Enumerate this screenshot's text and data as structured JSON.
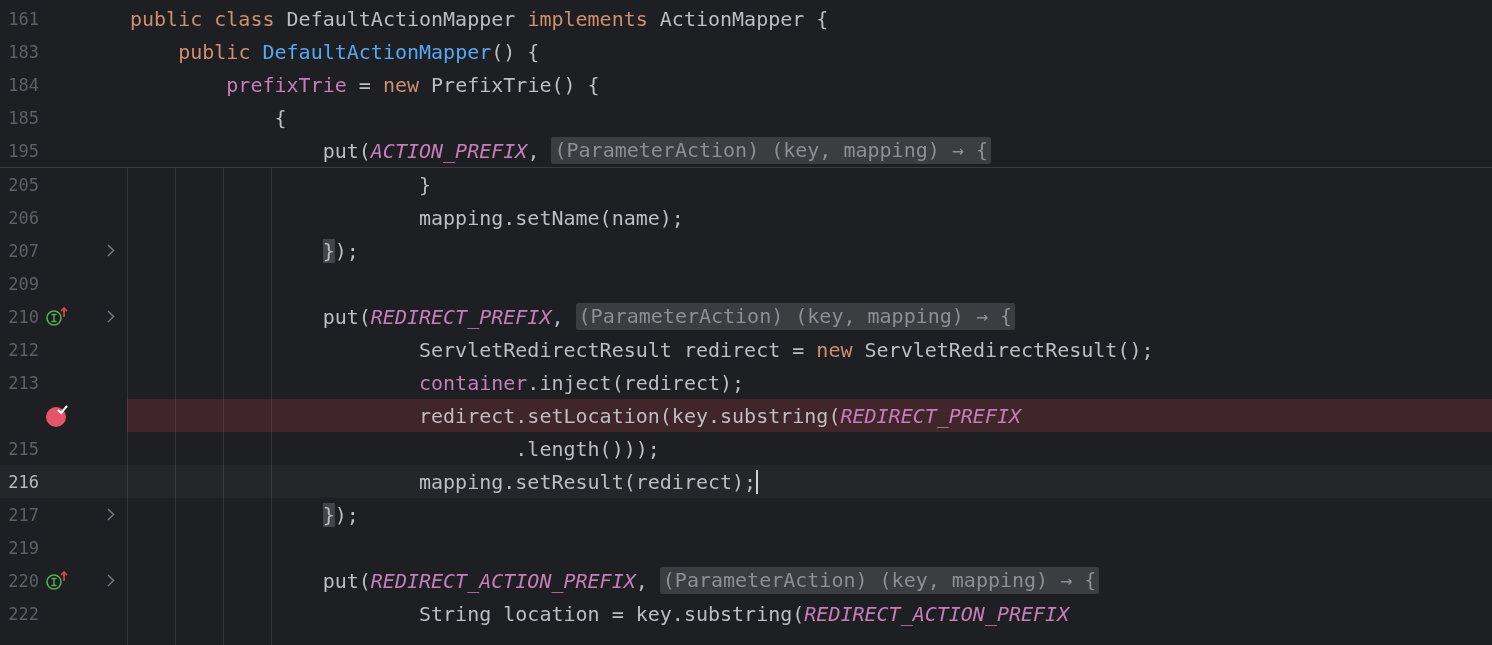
{
  "editor": {
    "sticky_lines": [
      {
        "number": "161",
        "tokens": [
          {
            "kind": "keyword",
            "text": "public class "
          },
          {
            "kind": "plain",
            "text": "DefaultActionMapper "
          },
          {
            "kind": "keyword",
            "text": "implements "
          },
          {
            "kind": "plain",
            "text": "ActionMapper {"
          }
        ]
      },
      {
        "number": "183",
        "tokens": [
          {
            "kind": "keyword",
            "text": "    public "
          },
          {
            "kind": "method",
            "text": "DefaultActionMapper"
          },
          {
            "kind": "plain",
            "text": "() {"
          }
        ]
      },
      {
        "number": "184",
        "tokens": [
          {
            "kind": "field",
            "text": "        prefixTrie"
          },
          {
            "kind": "plain",
            "text": " = "
          },
          {
            "kind": "keyword",
            "text": "new "
          },
          {
            "kind": "plain",
            "text": "PrefixTrie() {"
          }
        ]
      },
      {
        "number": "185",
        "tokens": [
          {
            "kind": "plain",
            "text": "            {"
          }
        ]
      },
      {
        "number": "195",
        "tokens": [
          {
            "kind": "plain",
            "text": "                put("
          },
          {
            "kind": "constant",
            "text": "ACTION_PREFIX"
          },
          {
            "kind": "plain",
            "text": ", "
          },
          {
            "kind": "hint",
            "text": "(ParameterAction) (key, mapping) → {"
          }
        ]
      }
    ],
    "lines": [
      {
        "number": "205",
        "implements_marker": false,
        "fold": false,
        "breakpoint": false,
        "current": false,
        "tokens": [
          {
            "kind": "plain",
            "text": "                        }"
          }
        ]
      },
      {
        "number": "206",
        "implements_marker": false,
        "fold": false,
        "breakpoint": false,
        "current": false,
        "tokens": [
          {
            "kind": "plain",
            "text": "                        mapping.setName(name);"
          }
        ]
      },
      {
        "number": "207",
        "implements_marker": false,
        "fold": true,
        "breakpoint": false,
        "current": false,
        "tokens": [
          {
            "kind": "matched_brace",
            "text": "                }"
          },
          {
            "kind": "plain",
            "text": ");"
          }
        ]
      },
      {
        "number": "209",
        "implements_marker": false,
        "fold": false,
        "breakpoint": false,
        "current": false
      },
      {
        "number": "210",
        "implements_marker": true,
        "fold": true,
        "breakpoint": false,
        "current": false,
        "tokens": [
          {
            "kind": "plain",
            "text": "                put("
          },
          {
            "kind": "constant",
            "text": "REDIRECT_PREFIX"
          },
          {
            "kind": "plain",
            "text": ", "
          },
          {
            "kind": "hint",
            "text": "(ParameterAction) (key, mapping) → {"
          }
        ]
      },
      {
        "number": "212",
        "implements_marker": false,
        "fold": false,
        "breakpoint": false,
        "current": false,
        "tokens": [
          {
            "kind": "plain",
            "text": "                        ServletRedirectResult redirect = "
          },
          {
            "kind": "keyword",
            "text": "new "
          },
          {
            "kind": "plain",
            "text": "ServletRedirectResult();"
          }
        ]
      },
      {
        "number": "213",
        "implements_marker": false,
        "fold": false,
        "breakpoint": false,
        "current": false,
        "tokens": [
          {
            "kind": "field",
            "text": "                        container"
          },
          {
            "kind": "plain",
            "text": ".inject(redirect);"
          }
        ]
      },
      {
        "implements_marker": false,
        "fold": false,
        "breakpoint": true,
        "current": false,
        "tokens": [
          {
            "kind": "plain",
            "text": "                        redirect.setLocation(key.substring("
          },
          {
            "kind": "constant",
            "text": "REDIRECT_PREFIX"
          }
        ]
      },
      {
        "number": "215",
        "implements_marker": false,
        "fold": false,
        "breakpoint": false,
        "current": false,
        "tokens": [
          {
            "kind": "plain",
            "text": "                                .length()));"
          }
        ]
      },
      {
        "number": "216",
        "implements_marker": false,
        "fold": false,
        "breakpoint": false,
        "current": true,
        "tokens": [
          {
            "kind": "plain",
            "text": "                        mapping.setResult(redirect);"
          }
        ]
      },
      {
        "number": "217",
        "implements_marker": false,
        "fold": true,
        "breakpoint": false,
        "current": false,
        "tokens": [
          {
            "kind": "matched_brace",
            "text": "                }"
          },
          {
            "kind": "plain",
            "text": ");"
          }
        ]
      },
      {
        "number": "219",
        "implements_marker": false,
        "fold": false,
        "breakpoint": false,
        "current": false
      },
      {
        "number": "220",
        "implements_marker": true,
        "fold": true,
        "breakpoint": false,
        "current": false,
        "tokens": [
          {
            "kind": "plain",
            "text": "                put("
          },
          {
            "kind": "constant",
            "text": "REDIRECT_ACTION_PREFIX"
          },
          {
            "kind": "plain",
            "text": ", "
          },
          {
            "kind": "hint",
            "text": "(ParameterAction) (key, mapping) → {"
          }
        ]
      },
      {
        "number": "222",
        "implements_marker": false,
        "fold": false,
        "breakpoint": false,
        "current": false,
        "tokens": [
          {
            "kind": "plain",
            "text": "                        String location = key.substring("
          },
          {
            "kind": "constant",
            "text": "REDIRECT_ACTION_PREFIX"
          }
        ]
      }
    ]
  }
}
